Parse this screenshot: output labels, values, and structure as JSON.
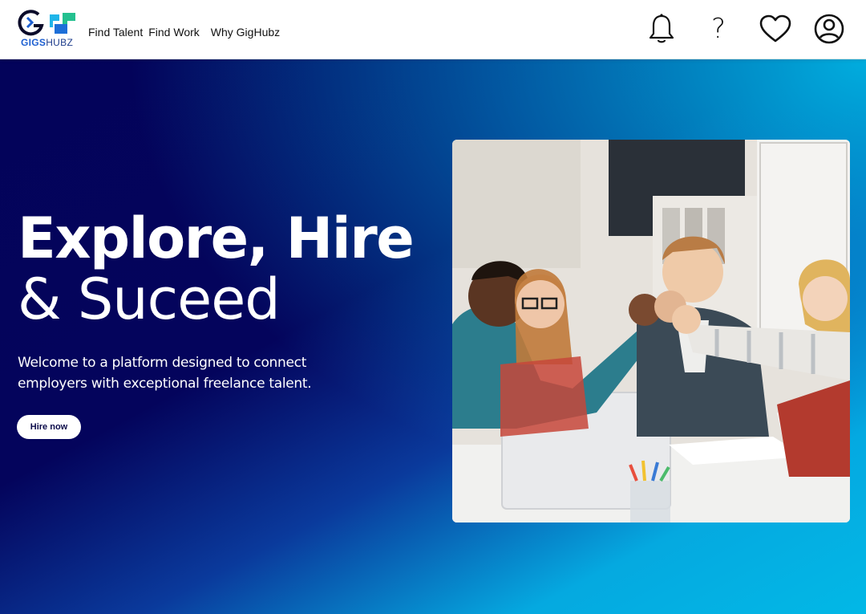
{
  "header": {
    "logo": {
      "part1": "GIGS",
      "part2": "HUBZ"
    },
    "nav": [
      {
        "label": "Find Talent"
      },
      {
        "label": "Find Work"
      },
      {
        "label": "Why GigHubz"
      }
    ],
    "icons": [
      "bell-icon",
      "help-icon",
      "heart-icon",
      "user-icon"
    ],
    "help_glyph": "?"
  },
  "hero": {
    "title_line1": "Explore, Hire",
    "title_line2": "& Suceed",
    "subtitle": "Welcome to a platform designed to connect employers with exceptional freelance talent.",
    "cta_label": "Hire now",
    "image": "team-fist-bump-photo"
  },
  "colors": {
    "navy": "#03035a",
    "cyan": "#02b8e6",
    "logo_blue": "#1d5fd1"
  }
}
